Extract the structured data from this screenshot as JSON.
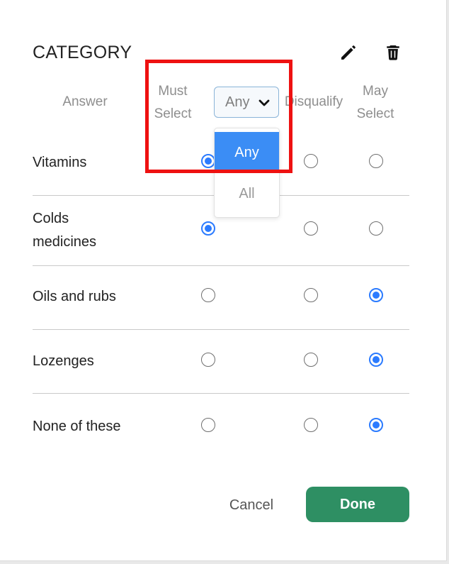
{
  "dialog": {
    "title": "CATEGORY",
    "edit_icon": "pencil-icon",
    "delete_icon": "trash-icon"
  },
  "columns": {
    "answer": "Answer",
    "must_select": [
      "Must",
      "Select"
    ],
    "disqualify": "Disqualify",
    "may_select": [
      "May",
      "Select"
    ]
  },
  "must_select_mode": {
    "value": "Any",
    "chevron_icon": "chevron-down-icon",
    "options": [
      "Any",
      "All"
    ],
    "highlighted_option": "Any"
  },
  "rows": [
    {
      "label_lines": [
        "Vitamins"
      ],
      "selected": "must_select"
    },
    {
      "label_lines": [
        "Colds",
        "medicines"
      ],
      "selected": "must_select"
    },
    {
      "label_lines": [
        "Oils and rubs"
      ],
      "selected": "may_select"
    },
    {
      "label_lines": [
        "Lozenges"
      ],
      "selected": "may_select"
    },
    {
      "label_lines": [
        "None of these"
      ],
      "selected": "may_select"
    }
  ],
  "footer": {
    "cancel_label": "Cancel",
    "done_label": "Done"
  },
  "colors": {
    "accent_blue": "#2b7bff",
    "dropdown_selected": "#3b8df5",
    "done_green": "#2e8f63",
    "highlight_red": "#ee1111"
  }
}
